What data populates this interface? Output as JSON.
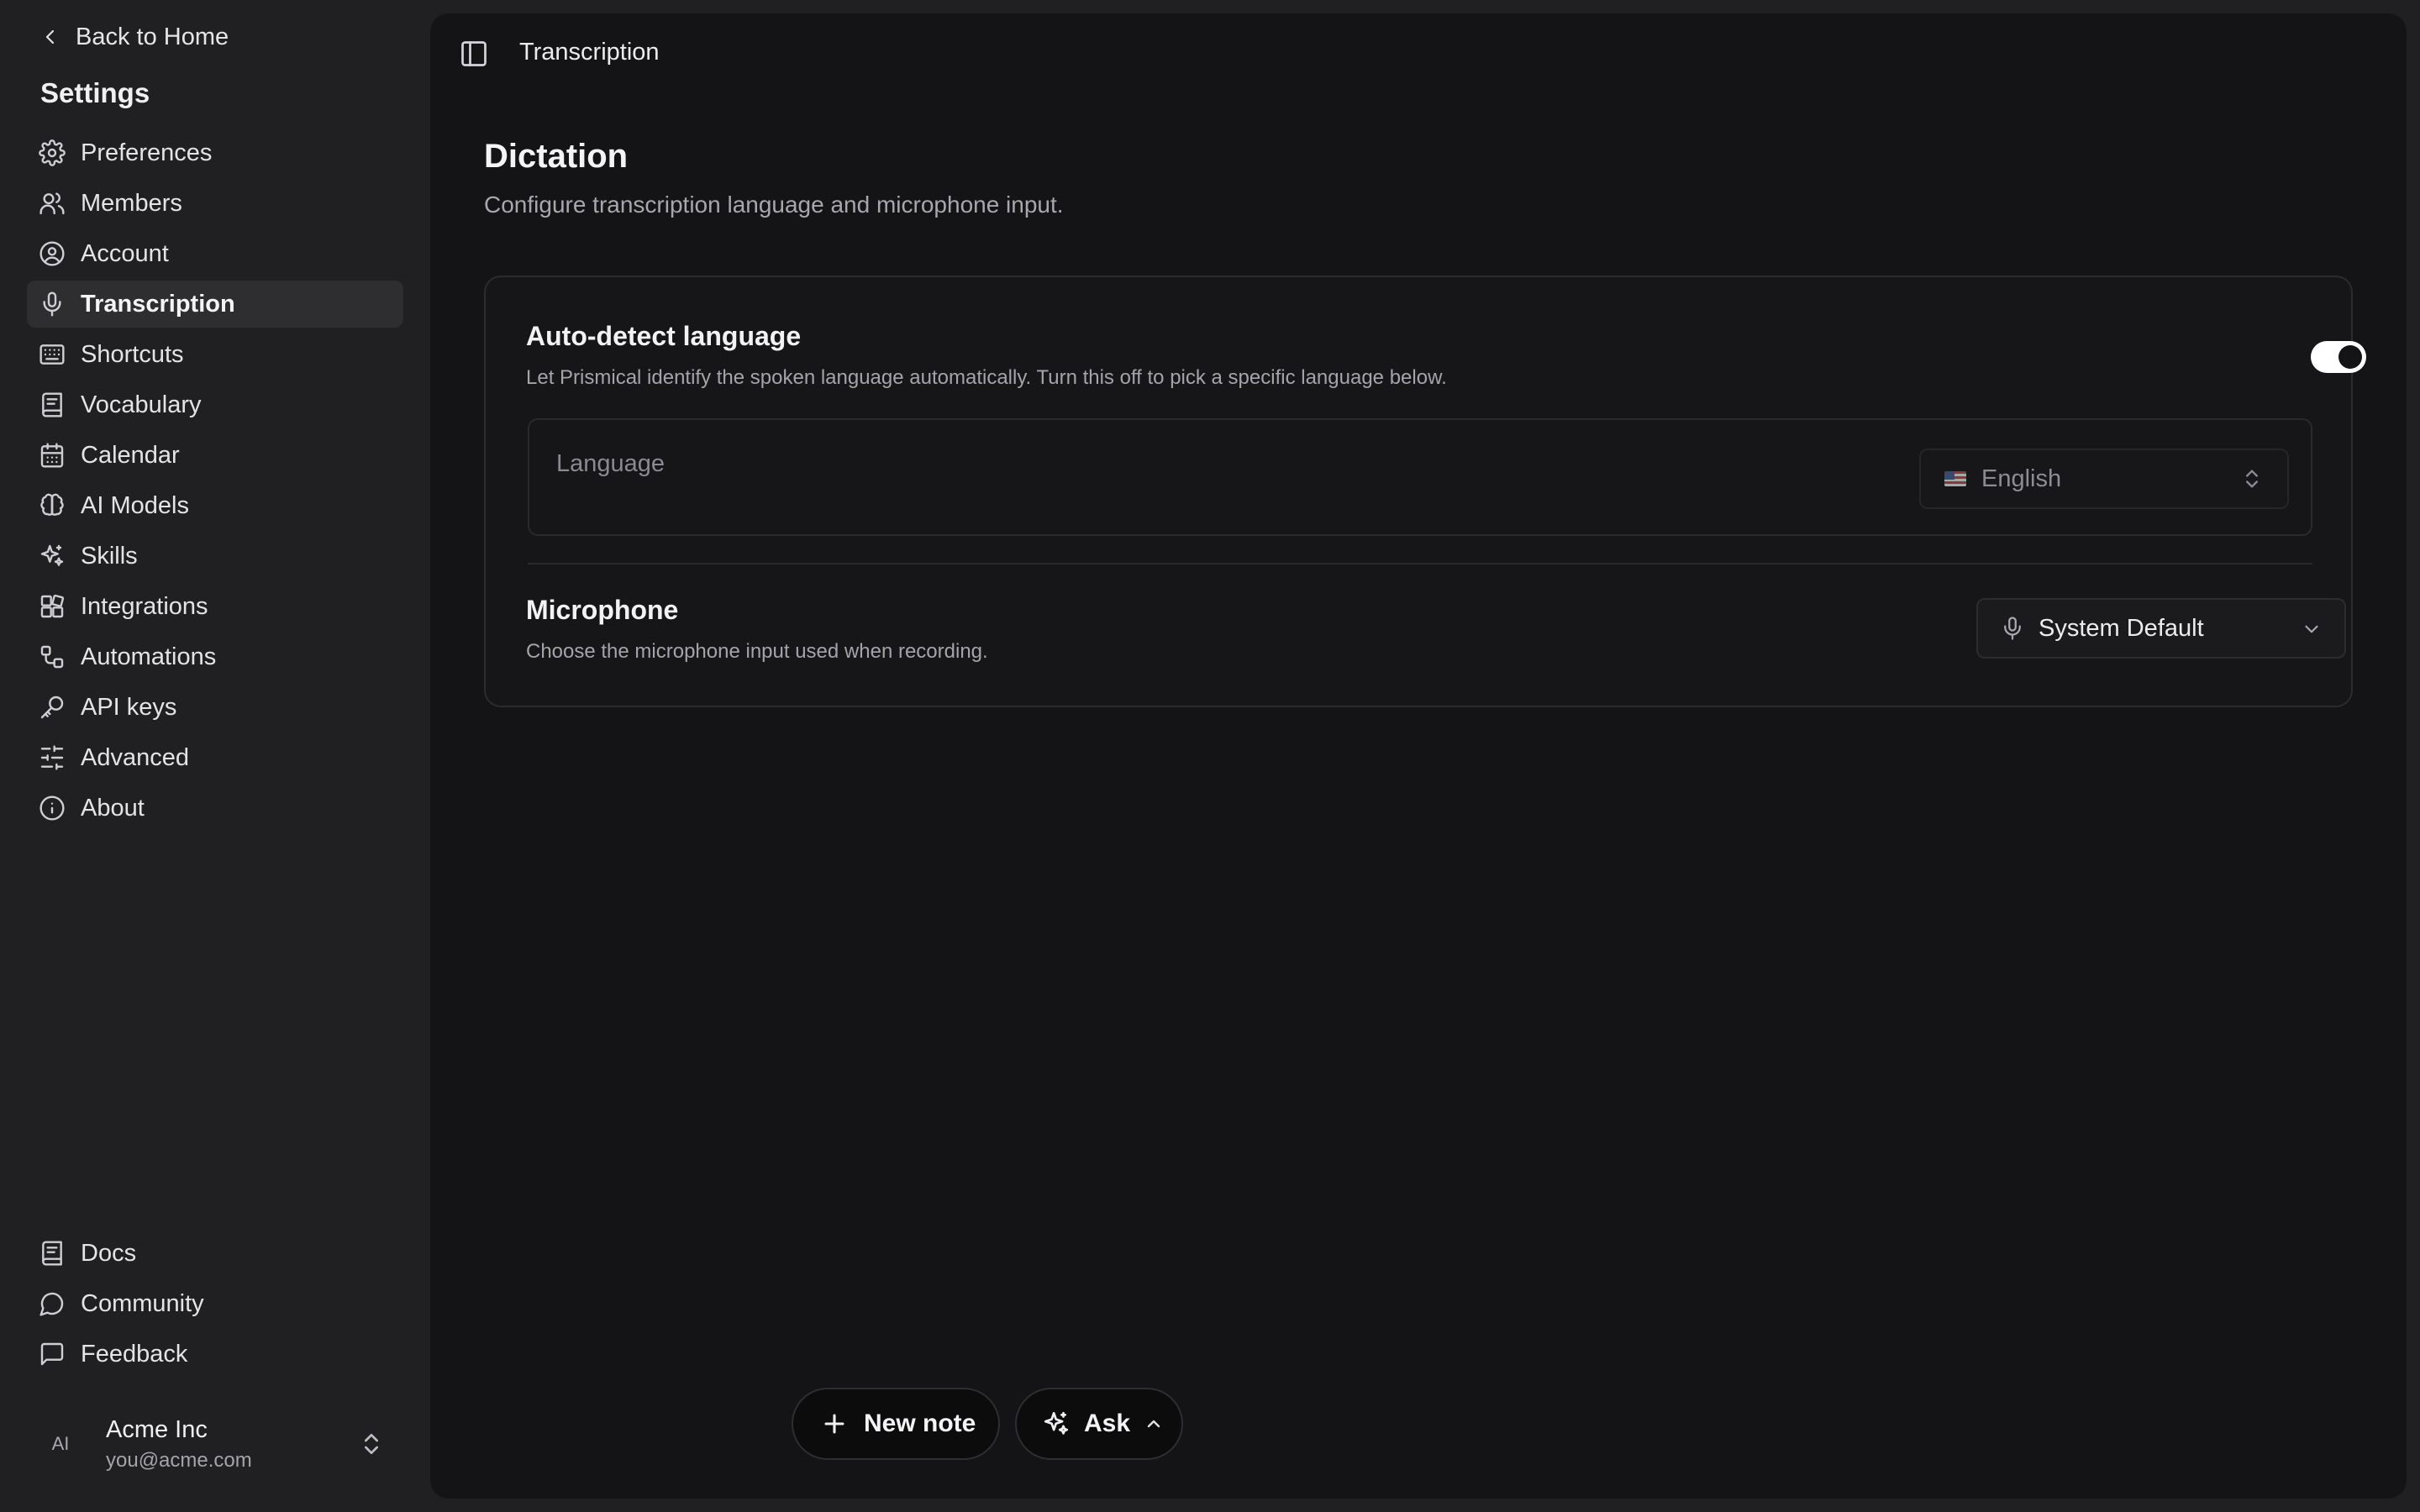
{
  "sidebar": {
    "back_label": "Back to Home",
    "title": "Settings",
    "items": [
      {
        "label": "Preferences",
        "icon": "gear-icon"
      },
      {
        "label": "Members",
        "icon": "users-icon"
      },
      {
        "label": "Account",
        "icon": "user-circle-icon"
      },
      {
        "label": "Transcription",
        "icon": "microphone-icon",
        "active": true
      },
      {
        "label": "Shortcuts",
        "icon": "keyboard-icon"
      },
      {
        "label": "Vocabulary",
        "icon": "book-icon"
      },
      {
        "label": "Calendar",
        "icon": "calendar-icon"
      },
      {
        "label": "AI Models",
        "icon": "brain-icon"
      },
      {
        "label": "Skills",
        "icon": "sparkles-icon"
      },
      {
        "label": "Integrations",
        "icon": "blocks-icon"
      },
      {
        "label": "Automations",
        "icon": "workflow-icon"
      },
      {
        "label": "API keys",
        "icon": "key-icon"
      },
      {
        "label": "Advanced",
        "icon": "sliders-icon"
      },
      {
        "label": "About",
        "icon": "info-icon"
      }
    ],
    "bottom_items": [
      {
        "label": "Docs",
        "icon": "book-icon"
      },
      {
        "label": "Community",
        "icon": "chat-bubble-icon"
      },
      {
        "label": "Feedback",
        "icon": "message-square-icon"
      }
    ],
    "account": {
      "avatar_initials": "AI",
      "name": "Acme Inc",
      "email": "you@acme.com"
    }
  },
  "topbar": {
    "title": "Transcription"
  },
  "page": {
    "title": "Dictation",
    "subtitle": "Configure transcription language and microphone input."
  },
  "auto_detect": {
    "title": "Auto-detect language",
    "description": "Let Prismical identify the spoken language automatically. Turn this off to pick a specific language below.",
    "enabled": true
  },
  "language": {
    "label": "Language",
    "value": "English",
    "flag": "us-flag-icon"
  },
  "microphone": {
    "title": "Microphone",
    "description": "Choose the microphone input used when recording.",
    "value": "System Default"
  },
  "actions": {
    "new_note_label": "New note",
    "ask_label": "Ask"
  },
  "colors": {
    "sidebar_bg": "#202022",
    "main_bg": "#141416",
    "toggle_on": "#ffffff",
    "active_item_bg": "#2e2e31"
  }
}
